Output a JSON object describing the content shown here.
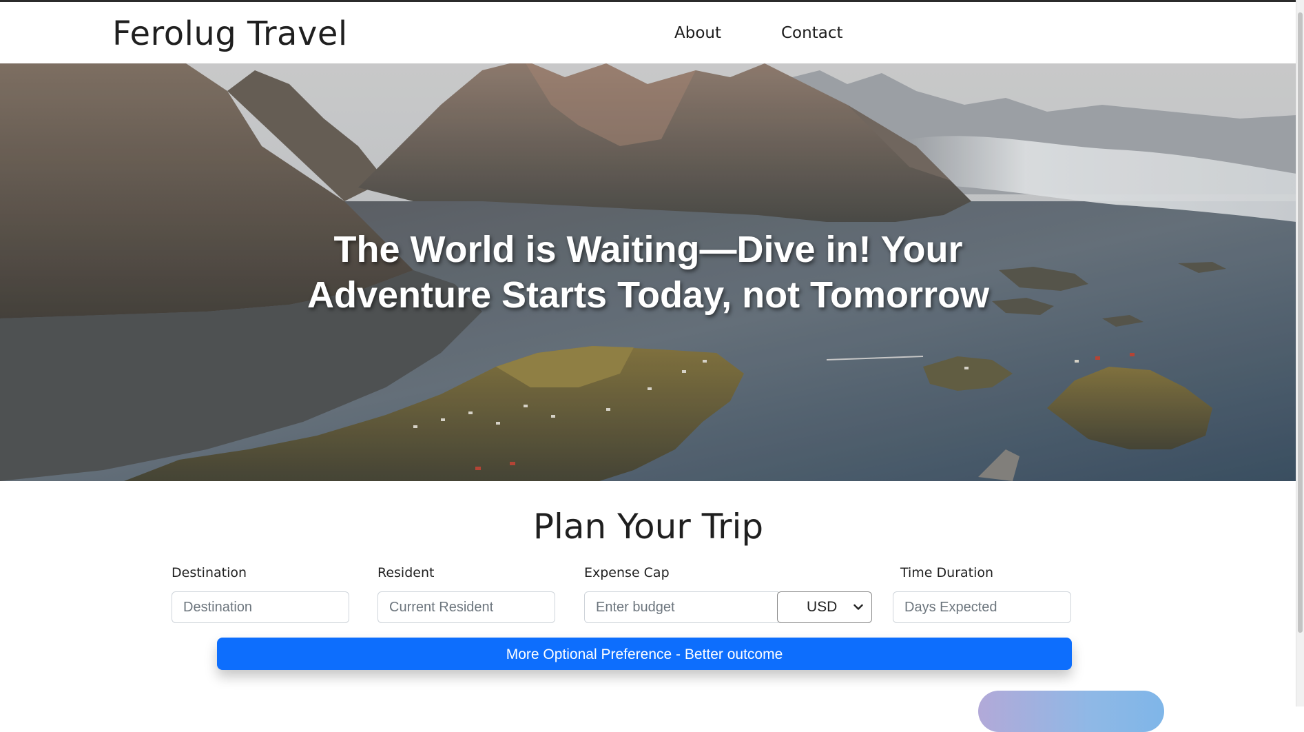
{
  "header": {
    "brand": "Ferolug Travel",
    "nav": [
      {
        "label": "About"
      },
      {
        "label": "Contact"
      }
    ]
  },
  "hero": {
    "line1": "The World is Waiting—Dive in! Your",
    "line2": "Adventure Starts Today, not Tomorrow"
  },
  "plan": {
    "title": "Plan Your Trip",
    "fields": {
      "destination": {
        "label": "Destination",
        "placeholder": "Destination",
        "value": ""
      },
      "resident": {
        "label": "Resident",
        "placeholder": "Current Resident",
        "value": ""
      },
      "expense": {
        "label": "Expense Cap",
        "placeholder": "Enter budget",
        "value": ""
      },
      "duration": {
        "label": "Time Duration",
        "placeholder": "Days Expected",
        "value": ""
      }
    },
    "currency": {
      "selected": "USD"
    },
    "preference_button": "More Optional Preference - Better outcome"
  },
  "theme": {
    "primary": "#0d6efd",
    "text": "#1f1f1f",
    "placeholder": "#6c757d"
  },
  "icons": [
    "chevron-down-icon"
  ]
}
